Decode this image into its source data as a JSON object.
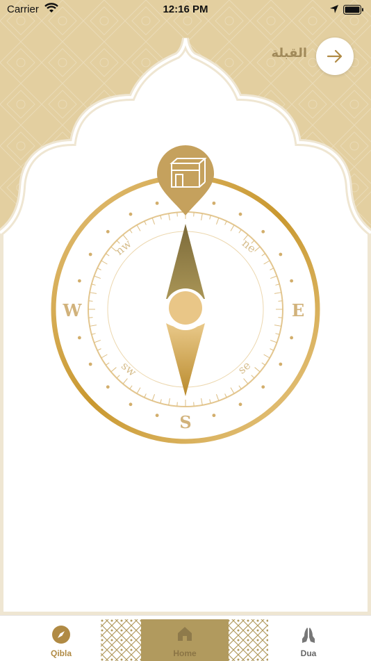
{
  "status_bar": {
    "carrier": "Carrier",
    "time": "12:16 PM"
  },
  "header": {
    "title": "القبلة"
  },
  "compass": {
    "labels": {
      "west": "W",
      "east": "E",
      "south": "S",
      "northwest": "nw",
      "northeast": "ne",
      "southwest": "sw",
      "southeast": "se"
    }
  },
  "tab_bar": {
    "items": [
      {
        "label": "Qibla",
        "icon": "compass-icon",
        "active": true
      },
      {
        "label": "Home",
        "icon": "home-icon",
        "active": false
      },
      {
        "label": "Dua",
        "icon": "praying-hands-icon",
        "active": false
      }
    ]
  },
  "colors": {
    "gold": "#c9a15a",
    "gold_dark": "#a9853f",
    "beige_bg": "#e3cfa0",
    "tab_active": "#b08a44"
  }
}
